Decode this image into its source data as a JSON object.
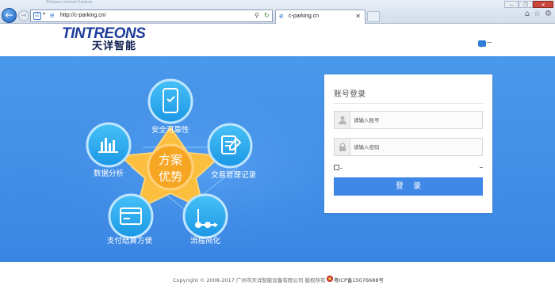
{
  "browser": {
    "window_title": "Windows Internet Explorer",
    "address_url": "http://c-parking.cn/",
    "tab_label": "c-parking.cn",
    "window_buttons": [
      "—",
      "❐",
      "✕"
    ]
  },
  "header": {
    "logo_text_en": "TINTREONS",
    "logo_text_cn": "天详智能"
  },
  "hub": {
    "label_line1": "方案",
    "label_line2": "优势"
  },
  "features": [
    {
      "label": "安全可靠性",
      "icon": "phone-shield-icon"
    },
    {
      "label": "交易管理记录",
      "icon": "document-edit-icon"
    },
    {
      "label": "流程简化",
      "icon": "flow-route-icon"
    },
    {
      "label": "支付结算方便",
      "icon": "card-icon"
    },
    {
      "label": "数据分析",
      "icon": "bar-chart-icon"
    }
  ],
  "login": {
    "title": "账号登录",
    "username_placeholder": "请输入账号",
    "password_placeholder": "请输入密码",
    "submit_label": "登录"
  },
  "footer": {
    "copyright": "Copyright © 2008-2017 广州市天详智能设备有限公司 版权所有",
    "icp": "粤ICP备15076688号"
  },
  "colors": {
    "banner": "#3f8ce6",
    "star": "#fbbe3e",
    "hub": "#f6a623",
    "feature_circle": "#29a8ef",
    "button": "#3f88e8"
  }
}
